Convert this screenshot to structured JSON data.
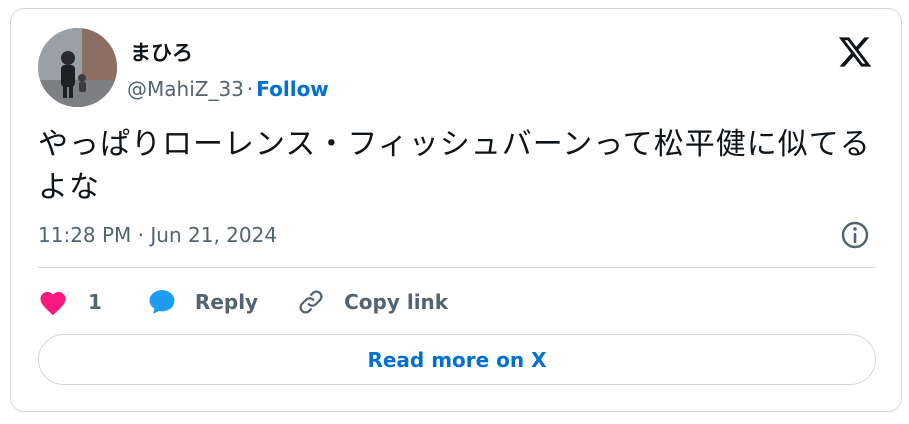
{
  "author": {
    "display_name": "まひろ",
    "handle": "@MahiZ_33",
    "separator": "·",
    "follow_label": "Follow"
  },
  "tweet": {
    "text": "やっぱりローレンス・フィッシュバーンって松平健に似てるよな",
    "timestamp": "11:28 PM · Jun 21, 2024"
  },
  "actions": {
    "like_count": "1",
    "reply_label": "Reply",
    "copy_link_label": "Copy link"
  },
  "read_more_label": "Read more on X",
  "icons": {
    "logo": "x-logo-icon",
    "info": "info-icon",
    "like": "heart-icon",
    "reply": "speech-bubble-icon",
    "copy_link": "link-icon"
  },
  "colors": {
    "link_blue": "#006fd6",
    "heart_pink": "#f91880",
    "reply_blue": "#1d9bf0",
    "secondary_text": "#536471",
    "border": "#cfd9de"
  }
}
